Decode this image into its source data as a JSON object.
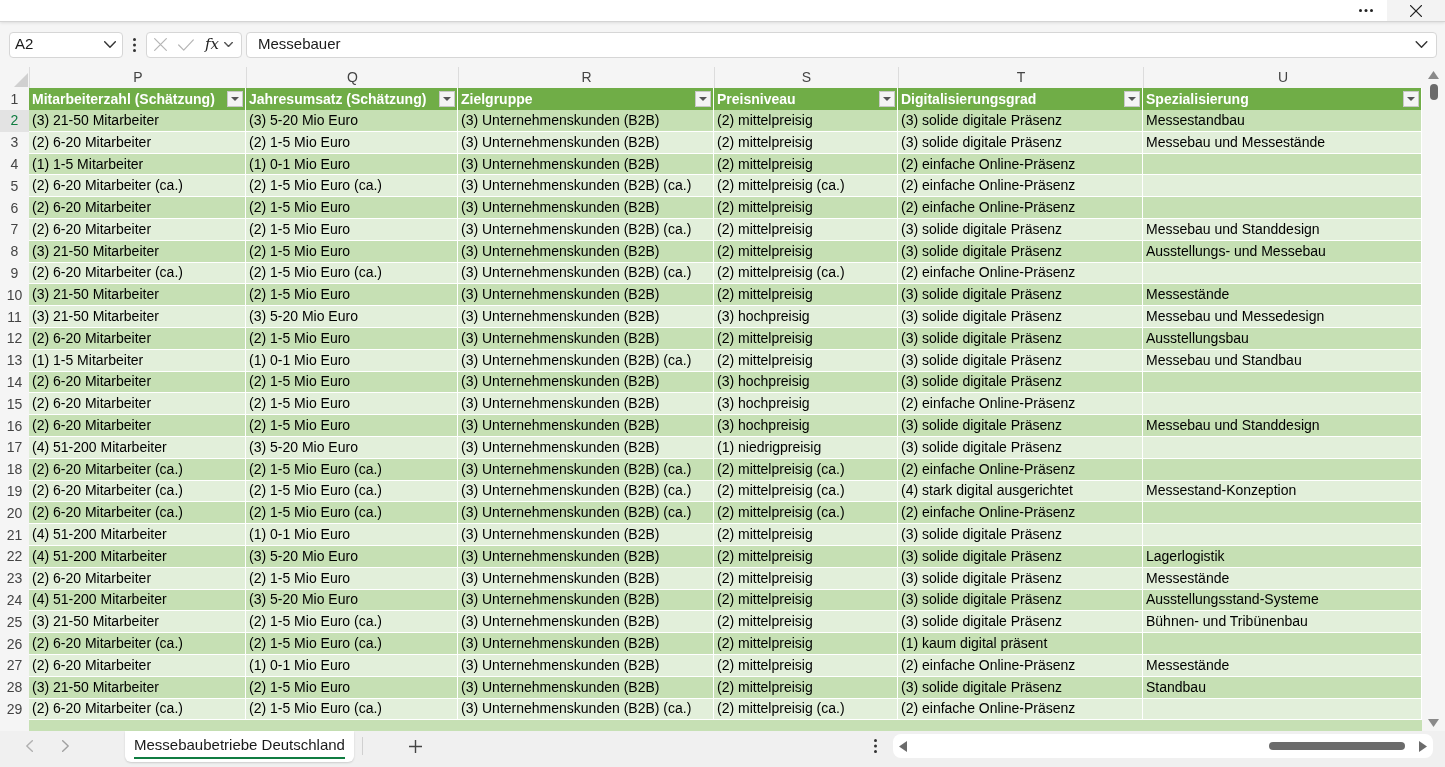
{
  "formula_bar": {
    "name_box": "A2",
    "function_label": "fx",
    "formula": "Messebauer"
  },
  "grid": {
    "header_row_number": "1",
    "columns": [
      {
        "letter": "P",
        "header": "Mitarbeiterzahl (Schätzung)"
      },
      {
        "letter": "Q",
        "header": "Jahresumsatz (Schätzung)"
      },
      {
        "letter": "R",
        "header": "Zielgruppe"
      },
      {
        "letter": "S",
        "header": "Preisniveau"
      },
      {
        "letter": "T",
        "header": "Digitalisierungsgrad"
      },
      {
        "letter": "U",
        "header": "Spezialisierung"
      }
    ],
    "rows": [
      {
        "number": "2",
        "selected": true,
        "cells": [
          "(3) 21-50 Mitarbeiter",
          "(3) 5-20 Mio Euro",
          "(3) Unternehmenskunden (B2B)",
          "(2) mittelpreisig",
          "(3) solide digitale Präsenz",
          "Messestandbau"
        ]
      },
      {
        "number": "3",
        "selected": false,
        "cells": [
          "(2) 6-20 Mitarbeiter",
          "(2) 1-5 Mio Euro",
          "(3) Unternehmenskunden (B2B)",
          "(2) mittelpreisig",
          "(3) solide digitale Präsenz",
          "Messebau und Messestände"
        ]
      },
      {
        "number": "4",
        "selected": false,
        "cells": [
          "(1) 1-5 Mitarbeiter",
          "(1) 0-1 Mio Euro",
          "(3) Unternehmenskunden (B2B)",
          "(2) mittelpreisig",
          "(2) einfache Online-Präsenz"
        ]
      },
      {
        "number": "5",
        "selected": false,
        "cells": [
          "(2) 6-20 Mitarbeiter (ca.)",
          "(2) 1-5 Mio Euro (ca.)",
          "(3) Unternehmenskunden (B2B) (ca.)",
          "(2) mittelpreisig (ca.)",
          "(2) einfache Online-Präsenz"
        ]
      },
      {
        "number": "6",
        "selected": false,
        "cells": [
          "(2) 6-20 Mitarbeiter",
          "(2) 1-5 Mio Euro",
          "(3) Unternehmenskunden (B2B)",
          "(2) mittelpreisig",
          "(2) einfache Online-Präsenz"
        ]
      },
      {
        "number": "7",
        "selected": false,
        "cells": [
          "(2) 6-20 Mitarbeiter",
          "(2) 1-5 Mio Euro",
          "(3) Unternehmenskunden (B2B) (ca.)",
          "(2) mittelpreisig",
          "(3) solide digitale Präsenz",
          "Messebau und Standdesign"
        ]
      },
      {
        "number": "8",
        "selected": false,
        "cells": [
          "(3) 21-50 Mitarbeiter",
          "(2) 1-5 Mio Euro",
          "(3) Unternehmenskunden (B2B)",
          "(2) mittelpreisig",
          "(3) solide digitale Präsenz",
          "Ausstellungs- und Messebau"
        ]
      },
      {
        "number": "9",
        "selected": false,
        "cells": [
          "(2) 6-20 Mitarbeiter (ca.)",
          "(2) 1-5 Mio Euro (ca.)",
          "(3) Unternehmenskunden (B2B) (ca.)",
          "(2) mittelpreisig (ca.)",
          "(2) einfache Online-Präsenz"
        ]
      },
      {
        "number": "10",
        "selected": false,
        "cells": [
          "(3) 21-50 Mitarbeiter",
          "(2) 1-5 Mio Euro",
          "(3) Unternehmenskunden (B2B)",
          "(2) mittelpreisig",
          "(3) solide digitale Präsenz",
          "Messestände"
        ]
      },
      {
        "number": "11",
        "selected": false,
        "cells": [
          "(3) 21-50 Mitarbeiter",
          "(3) 5-20 Mio Euro",
          "(3) Unternehmenskunden (B2B)",
          "(3) hochpreisig",
          "(3) solide digitale Präsenz",
          "Messebau und Messedesign"
        ]
      },
      {
        "number": "12",
        "selected": false,
        "cells": [
          "(2) 6-20 Mitarbeiter",
          "(2) 1-5 Mio Euro",
          "(3) Unternehmenskunden (B2B)",
          "(2) mittelpreisig",
          "(3) solide digitale Präsenz",
          "Ausstellungsbau"
        ]
      },
      {
        "number": "13",
        "selected": false,
        "cells": [
          "(1) 1-5 Mitarbeiter",
          "(1) 0-1 Mio Euro",
          "(3) Unternehmenskunden (B2B) (ca.)",
          "(2) mittelpreisig",
          "(3) solide digitale Präsenz",
          "Messebau und Standbau"
        ]
      },
      {
        "number": "14",
        "selected": false,
        "cells": [
          "(2) 6-20 Mitarbeiter",
          "(2) 1-5 Mio Euro",
          "(3) Unternehmenskunden (B2B)",
          "(3) hochpreisig",
          "(3) solide digitale Präsenz"
        ]
      },
      {
        "number": "15",
        "selected": false,
        "cells": [
          "(2) 6-20 Mitarbeiter",
          "(2) 1-5 Mio Euro",
          "(3) Unternehmenskunden (B2B)",
          "(3) hochpreisig",
          "(2) einfache Online-Präsenz"
        ]
      },
      {
        "number": "16",
        "selected": false,
        "cells": [
          "(2) 6-20 Mitarbeiter",
          "(2) 1-5 Mio Euro",
          "(3) Unternehmenskunden (B2B)",
          "(3) hochpreisig",
          "(3) solide digitale Präsenz",
          "Messebau und Standdesign"
        ]
      },
      {
        "number": "17",
        "selected": false,
        "cells": [
          "(4) 51-200 Mitarbeiter",
          "(3) 5-20 Mio Euro",
          "(3) Unternehmenskunden (B2B)",
          "(1) niedrigpreisig",
          "(3) solide digitale Präsenz"
        ]
      },
      {
        "number": "18",
        "selected": false,
        "cells": [
          "(2) 6-20 Mitarbeiter (ca.)",
          "(2) 1-5 Mio Euro (ca.)",
          "(3) Unternehmenskunden (B2B) (ca.)",
          "(2) mittelpreisig (ca.)",
          "(2) einfache Online-Präsenz"
        ]
      },
      {
        "number": "19",
        "selected": false,
        "cells": [
          "(2) 6-20 Mitarbeiter (ca.)",
          "(2) 1-5 Mio Euro (ca.)",
          "(3) Unternehmenskunden (B2B) (ca.)",
          "(2) mittelpreisig (ca.)",
          "(4) stark digital ausgerichtet",
          "Messestand-Konzeption"
        ]
      },
      {
        "number": "20",
        "selected": false,
        "cells": [
          "(2) 6-20 Mitarbeiter (ca.)",
          "(2) 1-5 Mio Euro (ca.)",
          "(3) Unternehmenskunden (B2B) (ca.)",
          "(2) mittelpreisig (ca.)",
          "(2) einfache Online-Präsenz"
        ]
      },
      {
        "number": "21",
        "selected": false,
        "cells": [
          "(4) 51-200 Mitarbeiter",
          "(1) 0-1 Mio Euro",
          "(3) Unternehmenskunden (B2B)",
          "(2) mittelpreisig",
          "(3) solide digitale Präsenz"
        ]
      },
      {
        "number": "22",
        "selected": false,
        "cells": [
          "(4) 51-200 Mitarbeiter",
          "(3) 5-20 Mio Euro",
          "(3) Unternehmenskunden (B2B)",
          "(2) mittelpreisig",
          "(3) solide digitale Präsenz",
          "Lagerlogistik"
        ]
      },
      {
        "number": "23",
        "selected": false,
        "cells": [
          "(2) 6-20 Mitarbeiter",
          "(2) 1-5 Mio Euro",
          "(3) Unternehmenskunden (B2B)",
          "(2) mittelpreisig",
          "(3) solide digitale Präsenz",
          "Messestände"
        ]
      },
      {
        "number": "24",
        "selected": false,
        "cells": [
          "(4) 51-200 Mitarbeiter",
          "(3) 5-20 Mio Euro",
          "(3) Unternehmenskunden (B2B)",
          "(2) mittelpreisig",
          "(3) solide digitale Präsenz",
          "Ausstellungsstand-Systeme"
        ]
      },
      {
        "number": "25",
        "selected": false,
        "cells": [
          "(3) 21-50 Mitarbeiter",
          "(2) 1-5 Mio Euro (ca.)",
          "(3) Unternehmenskunden (B2B)",
          "(2) mittelpreisig",
          "(3) solide digitale Präsenz",
          "Bühnen- und Tribünenbau"
        ]
      },
      {
        "number": "26",
        "selected": false,
        "cells": [
          "(2) 6-20 Mitarbeiter (ca.)",
          "(2) 1-5 Mio Euro (ca.)",
          "(3) Unternehmenskunden (B2B)",
          "(2) mittelpreisig",
          "(1) kaum digital präsent"
        ]
      },
      {
        "number": "27",
        "selected": false,
        "cells": [
          "(2) 6-20 Mitarbeiter",
          "(1) 0-1 Mio Euro",
          "(3) Unternehmenskunden (B2B)",
          "(2) mittelpreisig",
          "(2) einfache Online-Präsenz",
          "Messestände"
        ]
      },
      {
        "number": "28",
        "selected": false,
        "cells": [
          "(3) 21-50 Mitarbeiter",
          "(2) 1-5 Mio Euro",
          "(3) Unternehmenskunden (B2B)",
          "(2) mittelpreisig",
          "(3) solide digitale Präsenz",
          "Standbau"
        ]
      },
      {
        "number": "29",
        "selected": false,
        "cells": [
          "(2) 6-20 Mitarbeiter (ca.)",
          "(2) 1-5 Mio Euro (ca.)",
          "(3) Unternehmenskunden (B2B) (ca.)",
          "(2) mittelpreisig (ca.)",
          "(2) einfache Online-Präsenz"
        ]
      }
    ]
  },
  "sheet_tabs": [
    {
      "label": "Messebaubetriebe Deutschland",
      "selected": true
    }
  ]
}
